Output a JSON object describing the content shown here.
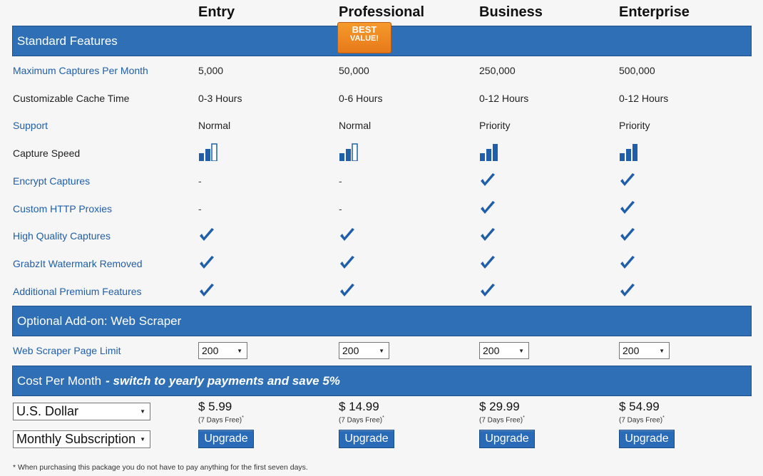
{
  "plans": [
    "Entry",
    "Professional",
    "Business",
    "Enterprise"
  ],
  "badge": {
    "line1": "BEST",
    "line2": "VALUE!"
  },
  "sections": {
    "standard": "Standard Features",
    "addon": "Optional Add-on: Web Scraper",
    "cost": "Cost Per Month",
    "cost_note": "- switch to yearly payments and save 5%"
  },
  "features": [
    {
      "label": "Maximum Captures Per Month",
      "values": [
        "5,000",
        "50,000",
        "250,000",
        "500,000"
      ]
    },
    {
      "label": "Customizable Cache Time",
      "values": [
        "0-3 Hours",
        "0-6 Hours",
        "0-12 Hours",
        "0-12 Hours"
      ]
    },
    {
      "label": "Support",
      "values": [
        "Normal",
        "Normal",
        "Priority",
        "Priority"
      ]
    },
    {
      "label": "Capture Speed",
      "values": [
        2,
        2,
        3,
        3
      ]
    },
    {
      "label": "Encrypt Captures",
      "values": [
        "-",
        "-",
        true,
        true
      ]
    },
    {
      "label": "Custom HTTP Proxies",
      "values": [
        "-",
        "-",
        true,
        true
      ]
    },
    {
      "label": "High Quality Captures",
      "values": [
        true,
        true,
        true,
        true
      ]
    },
    {
      "label": "GrabzIt Watermark Removed",
      "values": [
        true,
        true,
        true,
        true
      ]
    },
    {
      "label": "Additional Premium Features",
      "values": [
        true,
        true,
        true,
        true
      ]
    }
  ],
  "scraper": {
    "label": "Web Scraper Page Limit",
    "values": [
      "200",
      "200",
      "200",
      "200"
    ]
  },
  "currency_select": "U.S. Dollar",
  "billing_select": "Monthly Subscription",
  "prices": [
    "$ 5.99",
    "$ 14.99",
    "$ 29.99",
    "$ 54.99"
  ],
  "trial": "(7 Days Free)",
  "trial_mark": "*",
  "upgrade_label": "Upgrade",
  "footnote": "* When purchasing this package you do not have to pay anything for the first seven days.",
  "colors": {
    "band": "#2f6fb6",
    "link": "#1f5ea8",
    "badge": "#f08a24"
  }
}
